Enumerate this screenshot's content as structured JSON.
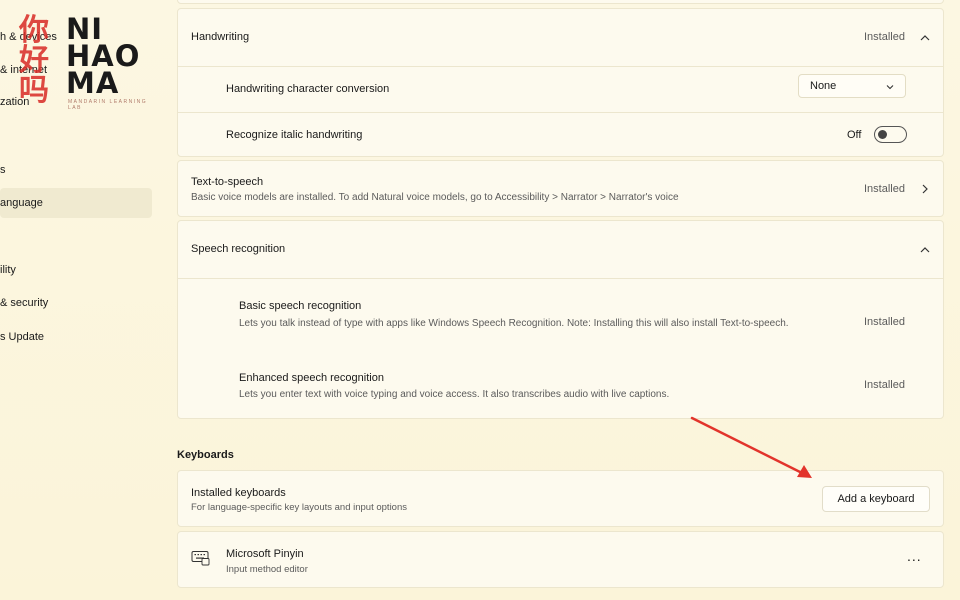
{
  "logo": {
    "cjk": [
      "你",
      "好",
      "吗"
    ],
    "latin": [
      "NI",
      "HAO",
      "MA"
    ],
    "tagline": "MANDARIN LEARNING LAB"
  },
  "sidebar": {
    "items": [
      {
        "label": "h & devices"
      },
      {
        "label": "& internet"
      },
      {
        "label": "zation"
      },
      {
        "label": "s"
      },
      {
        "label": "anguage"
      },
      {
        "label": "ility"
      },
      {
        "label": "& security"
      },
      {
        "label": "s Update"
      }
    ]
  },
  "handwriting": {
    "title": "Handwriting",
    "status": "Installed",
    "conversion_label": "Handwriting character conversion",
    "conversion_value": "None",
    "italic_label": "Recognize italic handwriting",
    "italic_state": "Off"
  },
  "tts": {
    "title": "Text-to-speech",
    "description": "Basic voice models are installed. To add Natural voice models, go to Accessibility > Narrator > Narrator's voice",
    "status": "Installed"
  },
  "speech": {
    "title": "Speech recognition",
    "basic_title": "Basic speech recognition",
    "basic_description": "Lets you talk instead of type with apps like Windows Speech Recognition. Note: Installing this will also install Text-to-speech.",
    "basic_status": "Installed",
    "enhanced_title": "Enhanced speech recognition",
    "enhanced_description": "Lets you enter text with voice typing and voice access. It also transcribes audio with live captions.",
    "enhanced_status": "Installed"
  },
  "keyboards": {
    "heading": "Keyboards",
    "installed_title": "Installed keyboards",
    "installed_description": "For language-specific key layouts and input options",
    "add_button": "Add a keyboard",
    "keyboard_name": "Microsoft Pinyin",
    "keyboard_type": "Input method editor",
    "more_label": "..."
  },
  "colors": {
    "accent_arrow": "#e2342c",
    "logo_red": "#d9302b"
  }
}
